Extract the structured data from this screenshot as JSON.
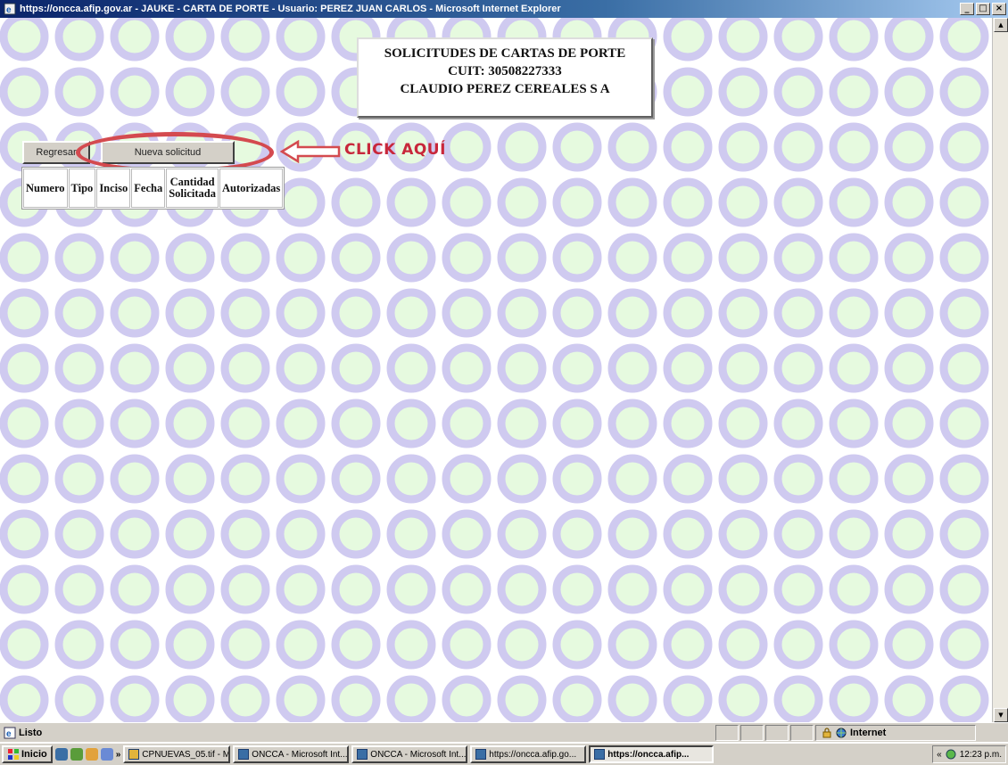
{
  "window": {
    "title": "https://oncca.afip.gov.ar - JAUKE - CARTA DE PORTE - Usuario: PEREZ JUAN CARLOS - Microsoft Internet Explorer",
    "minimize_glyph": "_",
    "maximize_glyph": "□",
    "close_glyph": "×"
  },
  "header": {
    "line1": "SOLICITUDES DE CARTAS DE PORTE",
    "line2": "CUIT: 30508227333",
    "line3": "CLAUDIO PEREZ CEREALES S A"
  },
  "buttons": {
    "regresar": "Regresar",
    "nueva_solicitud": "Nueva solicitud"
  },
  "annotation": {
    "text": "CLICK AQUÍ",
    "color": "#c8273b"
  },
  "table": {
    "col_numero": "Numero",
    "col_tipo": "Tipo",
    "col_inciso": "Inciso",
    "col_fecha": "Fecha",
    "col_cantidad_line1": "Cantidad",
    "col_cantidad_line2": "Solicitada",
    "col_autorizadas": "Autorizadas"
  },
  "statusbar": {
    "status": "Listo",
    "zone": "Internet"
  },
  "taskbar": {
    "start": "Inicio",
    "overflow": "»",
    "items": [
      "CPNUEVAS_05.tif - M...",
      "ONCCA - Microsoft Int...",
      "ONCCA - Microsoft Int...",
      "https://oncca.afip.go...",
      "https://oncca.afip..."
    ],
    "tray_overflow": "«",
    "clock": "12:23 p.m."
  }
}
